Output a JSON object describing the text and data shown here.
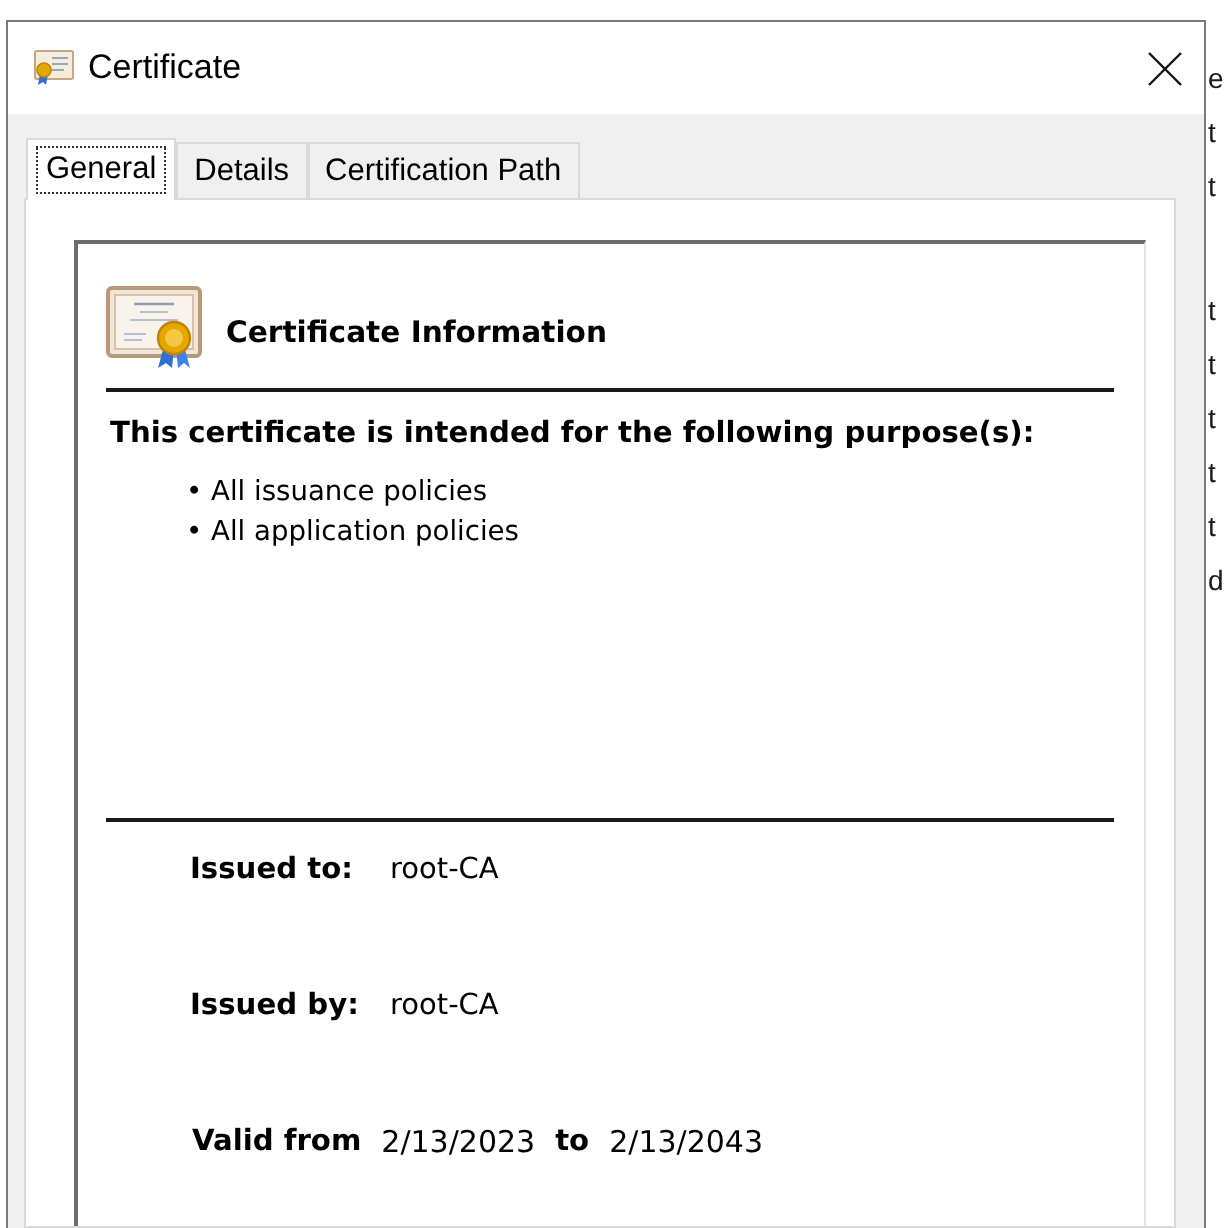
{
  "window": {
    "title": "Certificate"
  },
  "tabs": [
    {
      "label": "General",
      "selected": true
    },
    {
      "label": "Details",
      "selected": false
    },
    {
      "label": "Certification Path",
      "selected": false
    }
  ],
  "certificate_info": {
    "heading": "Certificate Information",
    "purpose_heading": "This certificate is intended for the following purpose(s):",
    "purposes": [
      "• All issuance policies",
      "• All application policies"
    ],
    "issued_to": {
      "label": "Issued to:",
      "value": "root-CA"
    },
    "issued_by": {
      "label": "Issued by:",
      "value": "root-CA"
    },
    "validity": {
      "from_label": "Valid from",
      "from": "2/13/2023",
      "to_label": "to",
      "to": "2/13/2043"
    }
  },
  "background_window": {
    "text_fragments": [
      [
        "e",
        "t",
        "t"
      ],
      [
        "t",
        "t",
        "t",
        "t",
        "t",
        "d"
      ]
    ]
  }
}
